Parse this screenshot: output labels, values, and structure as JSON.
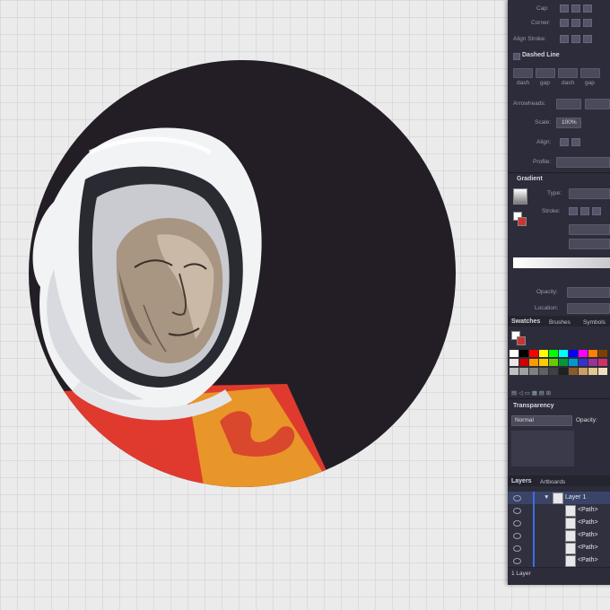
{
  "stroke_panel": {
    "cap_label": "Cap:",
    "corner_label": "Corner:",
    "align_stroke_label": "Align Stroke:",
    "dashed_line_label": "Dashed Line",
    "dash_labels": [
      "dash",
      "gap",
      "dash",
      "gap"
    ],
    "arrowheads_label": "Arrowheads:",
    "scale_label": "Scale:",
    "scale_value": "100%",
    "align_label": "Align:",
    "profile_label": "Profile:"
  },
  "gradient_panel": {
    "title": "Gradient",
    "type_label": "Type:",
    "stroke_label": "Stroke:",
    "opacity_label": "Opacity:",
    "location_label": "Location:"
  },
  "tabs": {
    "swatches": "Swatches",
    "brushes": "Brushes",
    "symbols": "Symbols"
  },
  "transparency_panel": {
    "title": "Transparency",
    "blend_mode": "Normal",
    "opacity_label": "Opacity:"
  },
  "layers_panel": {
    "tab_layers": "Layers",
    "tab_artboards": "Artboards",
    "layer_name": "Layer 1",
    "sublayers": [
      "<Path>",
      "<Path>",
      "<Path>",
      "<Path>",
      "<Path>"
    ],
    "footer_count": "1 Layer"
  },
  "swatch_colors": [
    "#ffffff",
    "#000000",
    "#ff0000",
    "#ffff00",
    "#00ff00",
    "#00ffff",
    "#0000ff",
    "#ff00ff",
    "#ff7f00",
    "#7f3f00",
    "#e8e8e8",
    "#cc0000",
    "#ff9900",
    "#ffcc00",
    "#66cc00",
    "#009933",
    "#0099cc",
    "#3333cc",
    "#993399",
    "#cc3366",
    "#c0c0c0",
    "#a0a0a0",
    "#808080",
    "#606060",
    "#404040",
    "#202020",
    "#8b5a2b",
    "#c8a064",
    "#e0c890",
    "#f0e0c0"
  ],
  "colors": {
    "panel_bg": "#2c2c3a",
    "circle": "#231e26",
    "suit_red": "#e03a2e",
    "suit_orange": "#e8952a",
    "helmet_white": "#f2f3f5",
    "face": "#a89582"
  }
}
